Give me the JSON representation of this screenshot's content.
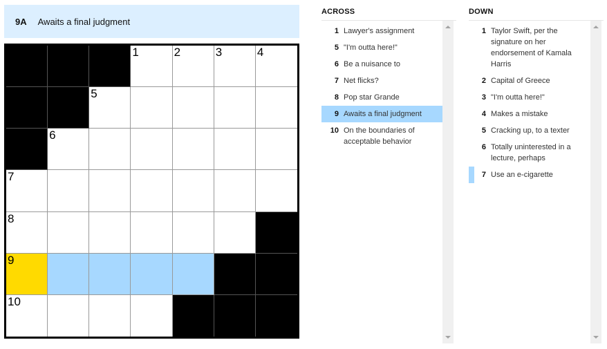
{
  "current_clue": {
    "label": "9A",
    "text": "Awaits a final judgment"
  },
  "grid": {
    "size": 7,
    "rows": [
      [
        "#",
        "#",
        "#",
        "1",
        "2",
        "3",
        "4"
      ],
      [
        "#",
        "#",
        "5",
        "",
        "",
        "",
        ""
      ],
      [
        "#",
        "6",
        "",
        "",
        "",
        "",
        ""
      ],
      [
        "7",
        "",
        "",
        "",
        "",
        "",
        ""
      ],
      [
        "8",
        "",
        "",
        "",
        "",
        "",
        "#"
      ],
      [
        "9",
        "",
        "",
        "",
        "",
        "#",
        "#"
      ],
      [
        "10",
        "",
        "",
        "",
        "#",
        "#",
        "#"
      ]
    ],
    "selected_cell": [
      5,
      0
    ],
    "highlighted_cells": [
      [
        5,
        1
      ],
      [
        5,
        2
      ],
      [
        5,
        3
      ],
      [
        5,
        4
      ]
    ]
  },
  "colors": {
    "highlight": "#a7d8ff",
    "selected": "#ffda00",
    "clue_bar": "#dcefff"
  },
  "across": {
    "title": "ACROSS",
    "clues": [
      {
        "num": "1",
        "text": "Lawyer's assignment"
      },
      {
        "num": "5",
        "text": "\"I'm outta here!\""
      },
      {
        "num": "6",
        "text": "Be a nuisance to"
      },
      {
        "num": "7",
        "text": "Net flicks?"
      },
      {
        "num": "8",
        "text": "Pop star Grande"
      },
      {
        "num": "9",
        "text": "Awaits a final judgment",
        "active": true
      },
      {
        "num": "10",
        "text": "On the boundaries of acceptable behavior"
      }
    ]
  },
  "down": {
    "title": "DOWN",
    "clues": [
      {
        "num": "1",
        "text": "Taylor Swift, per the signature on her endorsement of Kamala Harris"
      },
      {
        "num": "2",
        "text": "Capital of Greece"
      },
      {
        "num": "3",
        "text": "\"I'm outta here!\""
      },
      {
        "num": "4",
        "text": "Makes a mistake"
      },
      {
        "num": "5",
        "text": "Cracking up, to a texter"
      },
      {
        "num": "6",
        "text": "Totally uninterested in a lecture, perhaps"
      },
      {
        "num": "7",
        "text": "Use an e-cigarette",
        "cross": true
      }
    ]
  }
}
